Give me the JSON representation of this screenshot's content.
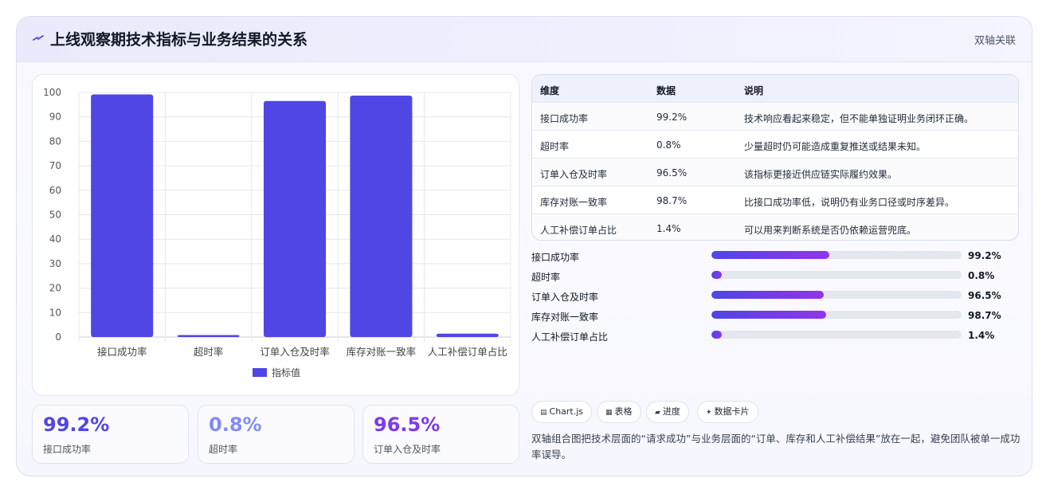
{
  "header": {
    "title": "上线观察期技术指标与业务结果的关系",
    "tag": "双轴关联",
    "icon": "bolt-icon"
  },
  "chart_data": {
    "type": "bar",
    "categories": [
      "接口成功率",
      "超时率",
      "订单入仓及时率",
      "库存对账一致率",
      "人工补偿订单占比"
    ],
    "series": [
      {
        "name": "指标值",
        "values": [
          99.2,
          0.8,
          96.5,
          98.7,
          1.4
        ],
        "color": "#4f46e5"
      }
    ],
    "y_ticks": [
      0,
      10,
      20,
      30,
      40,
      50,
      60,
      70,
      80,
      90,
      100
    ],
    "ylim": [
      0,
      100
    ],
    "grid": true,
    "legend_position": "bottom"
  },
  "stats": [
    {
      "value": "99.2%",
      "label": "接口成功率",
      "color": "#4f46e5"
    },
    {
      "value": "0.8%",
      "label": "超时率",
      "color": "#818cf8"
    },
    {
      "value": "96.5%",
      "label": "订单入仓及时率",
      "color": "#7c3aed"
    }
  ],
  "table": {
    "headers": [
      "维度",
      "数据",
      "说明"
    ],
    "rows": [
      [
        "接口成功率",
        "99.2%",
        "技术响应看起来稳定，但不能单独证明业务闭环正确。"
      ],
      [
        "超时率",
        "0.8%",
        "少量超时仍可能造成重复推送或结果未知。"
      ],
      [
        "订单入仓及时率",
        "96.5%",
        "该指标更接近供应链实际履约效果。"
      ],
      [
        "库存对账一致率",
        "98.7%",
        "比接口成功率低，说明仍有业务口径或时序差异。"
      ],
      [
        "人工补偿订单占比",
        "1.4%",
        "可以用来判断系统是否仍依赖运营兜底。"
      ]
    ]
  },
  "progress": [
    {
      "label": "接口成功率",
      "value_text": "99.2%",
      "fill_percent": 47
    },
    {
      "label": "超时率",
      "value_text": "0.8%",
      "fill_percent": 4
    },
    {
      "label": "订单入仓及时率",
      "value_text": "96.5%",
      "fill_percent": 45
    },
    {
      "label": "库存对账一致率",
      "value_text": "98.7%",
      "fill_percent": 46
    },
    {
      "label": "人工补偿订单占比",
      "value_text": "1.4%",
      "fill_percent": 4
    }
  ],
  "chips": [
    {
      "icon": "▤",
      "label": "Chart.js"
    },
    {
      "icon": "▦",
      "label": "表格"
    },
    {
      "icon": "▰",
      "label": "进度"
    },
    {
      "icon": "✦",
      "label": "数据卡片"
    }
  ],
  "footer_text": "双轴组合图把技术层面的“请求成功”与业务层面的“订单、库存和人工补偿结果”放在一起，避免团队被单一成功率误导。"
}
